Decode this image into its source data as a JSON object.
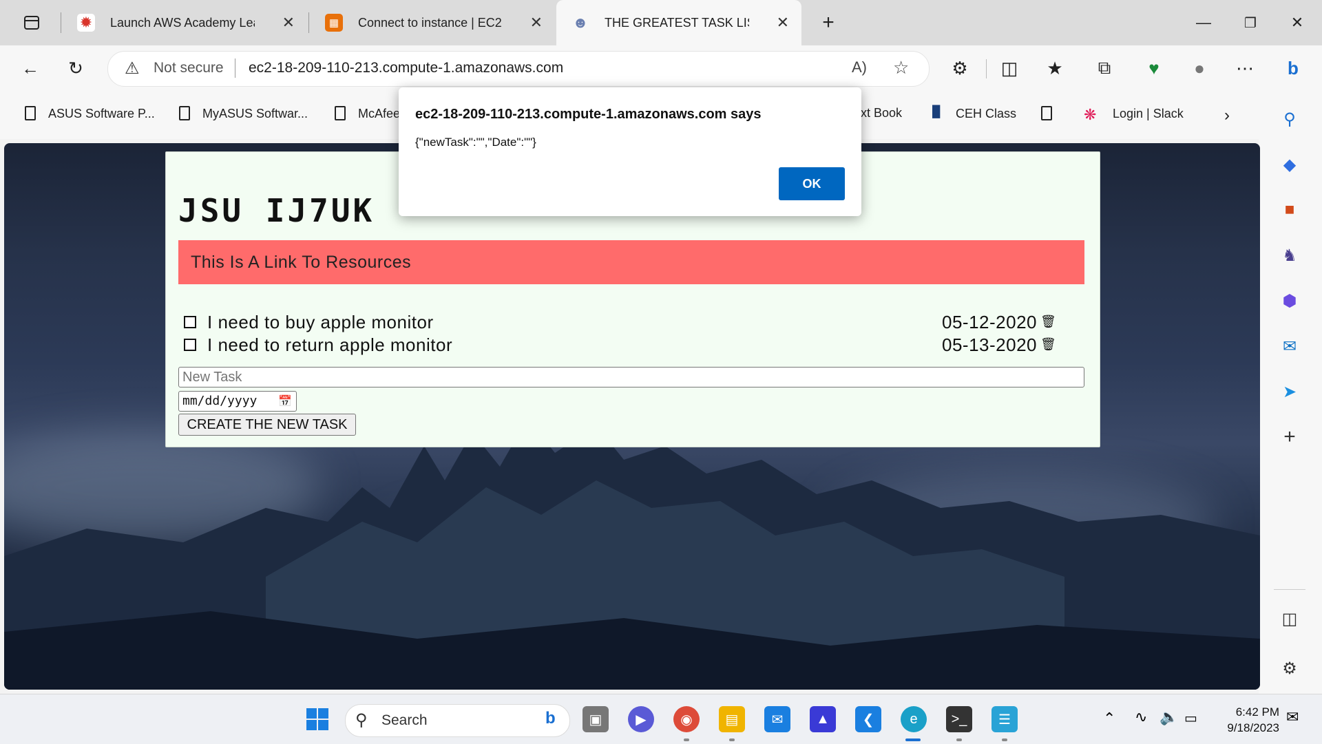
{
  "browser": {
    "tabs": [
      {
        "title": "Launch AWS Academy Lear",
        "icon": "aws-academy-icon",
        "active": false
      },
      {
        "title": "Connect to instance | EC2 |",
        "icon": "ec2-icon",
        "active": false
      },
      {
        "title": "THE GREATEST TASK LIST",
        "icon": "robot-icon",
        "active": true
      }
    ],
    "security_label": "Not secure",
    "url": "ec2-18-209-110-213.compute-1.amazonaws.com",
    "favorites": [
      {
        "label": "ASUS Software P..."
      },
      {
        "label": "MyASUS Softwar..."
      },
      {
        "label": "McAfee"
      },
      {
        "label": "xt Book"
      },
      {
        "label": "CEH Class"
      },
      {
        "label": ""
      },
      {
        "label": "Login | Slack"
      }
    ]
  },
  "app": {
    "logo_text": "JSU IJ7UK",
    "resource_link": "This Is A Link To Resources",
    "tasks": [
      {
        "text": "I need to buy apple monitor",
        "date": "05-12-2020",
        "checked": false
      },
      {
        "text": "I need to return apple monitor",
        "date": "05-13-2020",
        "checked": false
      }
    ],
    "new_task_placeholder": "New Task",
    "date_placeholder": "mm/dd/yyyy",
    "create_button": "CREATE THE NEW TASK"
  },
  "dialog": {
    "title": "ec2-18-209-110-213.compute-1.amazonaws.com says",
    "message": "{\"newTask\":\"\",\"Date\":\"\"}",
    "ok_label": "OK"
  },
  "taskbar": {
    "search_label": "Search",
    "time": "6:42 PM",
    "date": "9/18/2023"
  },
  "colors": {
    "resource_banner": "#ff6b6b",
    "card_background": "#f3fdf3",
    "dialog_ok": "#0067c0"
  }
}
